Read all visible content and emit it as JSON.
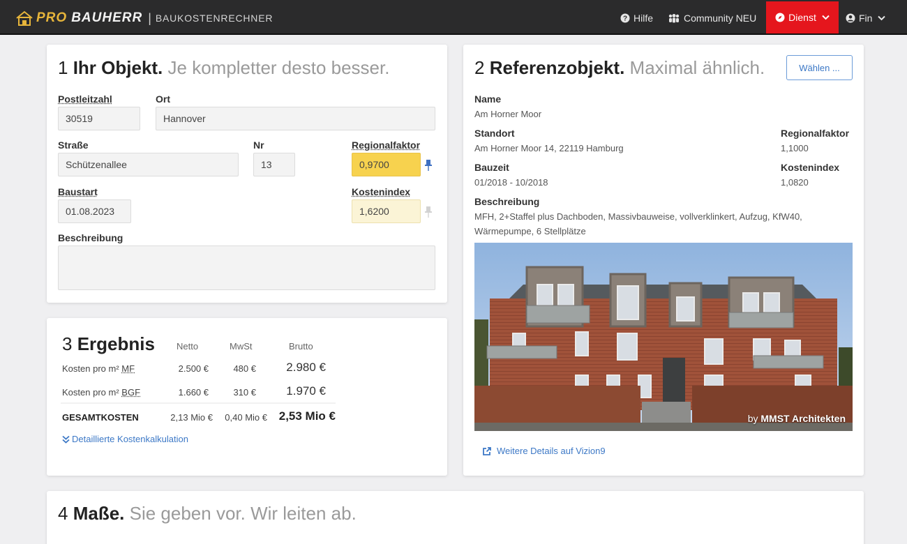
{
  "topbar": {
    "brand_pro": "PRO",
    "brand_bauherr": "BAUHERR",
    "brand_separator": "|",
    "brand_sub": "BAUKOSTENRECHNER",
    "nav": [
      {
        "label": "Hilfe",
        "icon": "question-circle-icon"
      },
      {
        "label": "Community NEU",
        "icon": "users-icon"
      },
      {
        "label": "Dienst",
        "icon": "compass-icon"
      },
      {
        "label": "Fin",
        "icon": "user-circle-icon"
      }
    ],
    "accent": "#e5161d",
    "brand_color": "#e7b53b"
  },
  "objekt": {
    "heading_num": "1",
    "heading_main": "Ihr Objekt.",
    "heading_muted": "Je kompletter desto besser.",
    "plz_label": "Postleitzahl",
    "plz_value": "30519",
    "ort_label": "Ort",
    "ort_value": "Hannover",
    "strasse_label": "Straße",
    "strasse_value": "Schützenallee",
    "nr_label": "Nr",
    "nr_value": "13",
    "regional_label": "Regionalfaktor",
    "regional_value": "0,9700",
    "baustart_label": "Baustart",
    "baustart_value": "01.08.2023",
    "kosten_label": "Kostenindex",
    "kosten_value": "1,6200",
    "beschreibung_label": "Beschreibung",
    "beschreibung_value": ""
  },
  "referenz": {
    "heading_num": "2",
    "heading_main": "Referenzobjekt.",
    "heading_muted": "Maximal ähnlich.",
    "choose_label": "Wählen ...",
    "name_label": "Name",
    "name_value": "Am Horner Moor",
    "standort_label": "Standort",
    "standort_value": "Am Horner Moor 14, 22119 Hamburg",
    "regional_label": "Regionalfaktor",
    "regional_value": "1,1000",
    "bauzeit_label": "Bauzeit",
    "bauzeit_value": "01/2018 - 10/2018",
    "kosten_label": "Kostenindex",
    "kosten_value": "1,0820",
    "beschreibung_label": "Beschreibung",
    "beschreibung_value": "MFH, 2+Staffel plus Dachboden, Massivbauweise, vollverklinkert, Aufzug, KfW40, Wärmepumpe, 6 Stellplätze",
    "credit_by": "by",
    "credit_name": "MMST Architekten",
    "link_label": "Weitere Details auf Vizion9"
  },
  "ergebnis": {
    "heading_num": "3",
    "heading_main": "Ergebnis",
    "col_netto": "Netto",
    "col_mwst": "MwSt",
    "col_brutto": "Brutto",
    "rows": [
      {
        "label": "Kosten pro m²",
        "abbr": "MF",
        "netto": "2.500 €",
        "mwst": "480 €",
        "brutto": "2.980 €"
      },
      {
        "label": "Kosten pro m²",
        "abbr": "BGF",
        "netto": "1.660 €",
        "mwst": "310 €",
        "brutto": "1.970 €"
      }
    ],
    "total_label": "GESAMTKOSTEN",
    "total_netto": "2,13 Mio €",
    "total_mwst": "0,40 Mio €",
    "total_brutto": "2,53 Mio €",
    "detail_link": "Detaillierte Kostenkalkulation"
  },
  "masse": {
    "heading_num": "4",
    "heading_main": "Maße.",
    "heading_muted": "Sie geben vor. Wir leiten ab."
  }
}
